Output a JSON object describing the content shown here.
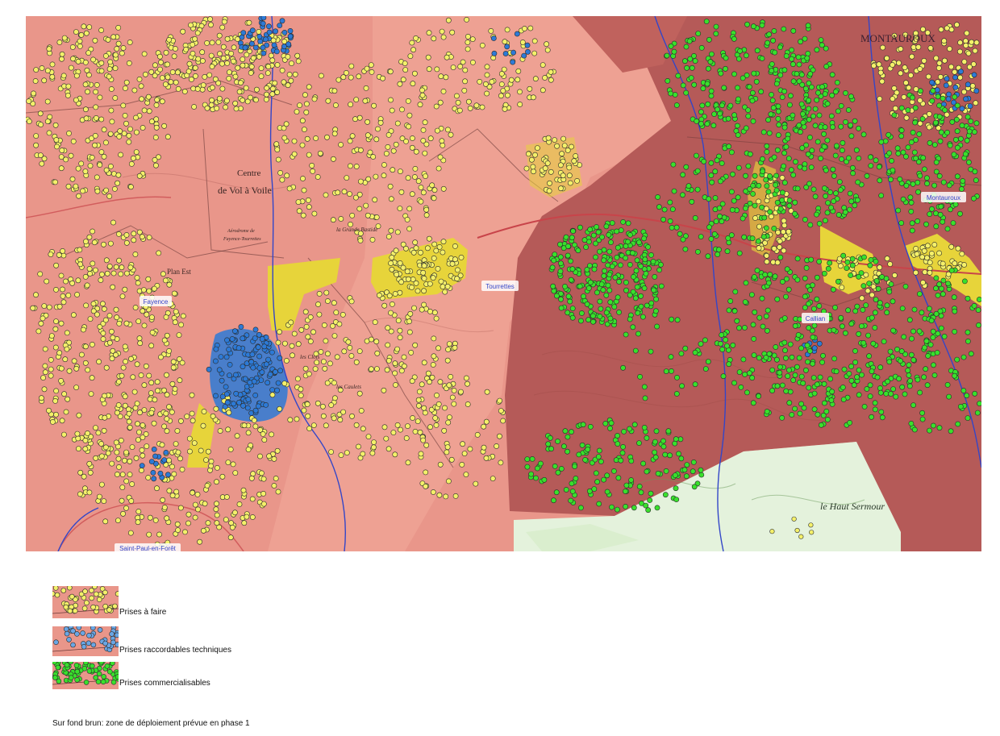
{
  "map": {
    "place_labels": [
      {
        "id": "fayence",
        "text": "Fayence"
      },
      {
        "id": "tourrettes",
        "text": "Tourrettes"
      },
      {
        "id": "callian",
        "text": "Callian"
      },
      {
        "id": "montauroux",
        "text": "Montauroux"
      },
      {
        "id": "saint-paul",
        "text": "Saint-Paul-en-Forêt"
      }
    ],
    "topo_labels": [
      {
        "id": "centre",
        "text": "Centre"
      },
      {
        "id": "vol-a-voile",
        "text": "de Vol à Voile"
      },
      {
        "id": "aerodrome",
        "text": "Aérodrome de"
      },
      {
        "id": "aerodrome2",
        "text": "Fayence-Tourrettes"
      },
      {
        "id": "grande-bastide",
        "text": "la Grande Bastide"
      },
      {
        "id": "plan-est",
        "text": "Plan Est"
      },
      {
        "id": "haut-sermour",
        "text": "le Haut Sermour"
      },
      {
        "id": "montauroux-big",
        "text": "MONTAUROUX"
      },
      {
        "id": "les-clots",
        "text": "les Clots"
      },
      {
        "id": "les-caulets",
        "text": "les Caulets"
      }
    ],
    "colors": {
      "base_pink": "#e9968a",
      "phase1_brown": "#b55a58",
      "green_area": "#e4f2dc",
      "yellow_zone": "#e7d43a",
      "yellow_dot": "#f4f06a",
      "blue_dot": "#2d7ad6",
      "green_dot": "#39e02c",
      "river": "#3346c8",
      "road": "#c8444a"
    }
  },
  "legend": {
    "items": [
      {
        "id": "prises-a-faire",
        "label": "Prises à faire",
        "dot_color": "#f4f06a"
      },
      {
        "id": "prises-raccordables",
        "label": "Prises raccordables techniques",
        "dot_color": "#6aa6e4"
      },
      {
        "id": "prises-commercialisables",
        "label": "Prises commercialisables",
        "dot_color": "#39e02c"
      }
    ]
  },
  "footnote": "Sur fond brun: zone de déploiement prévue en phase 1"
}
